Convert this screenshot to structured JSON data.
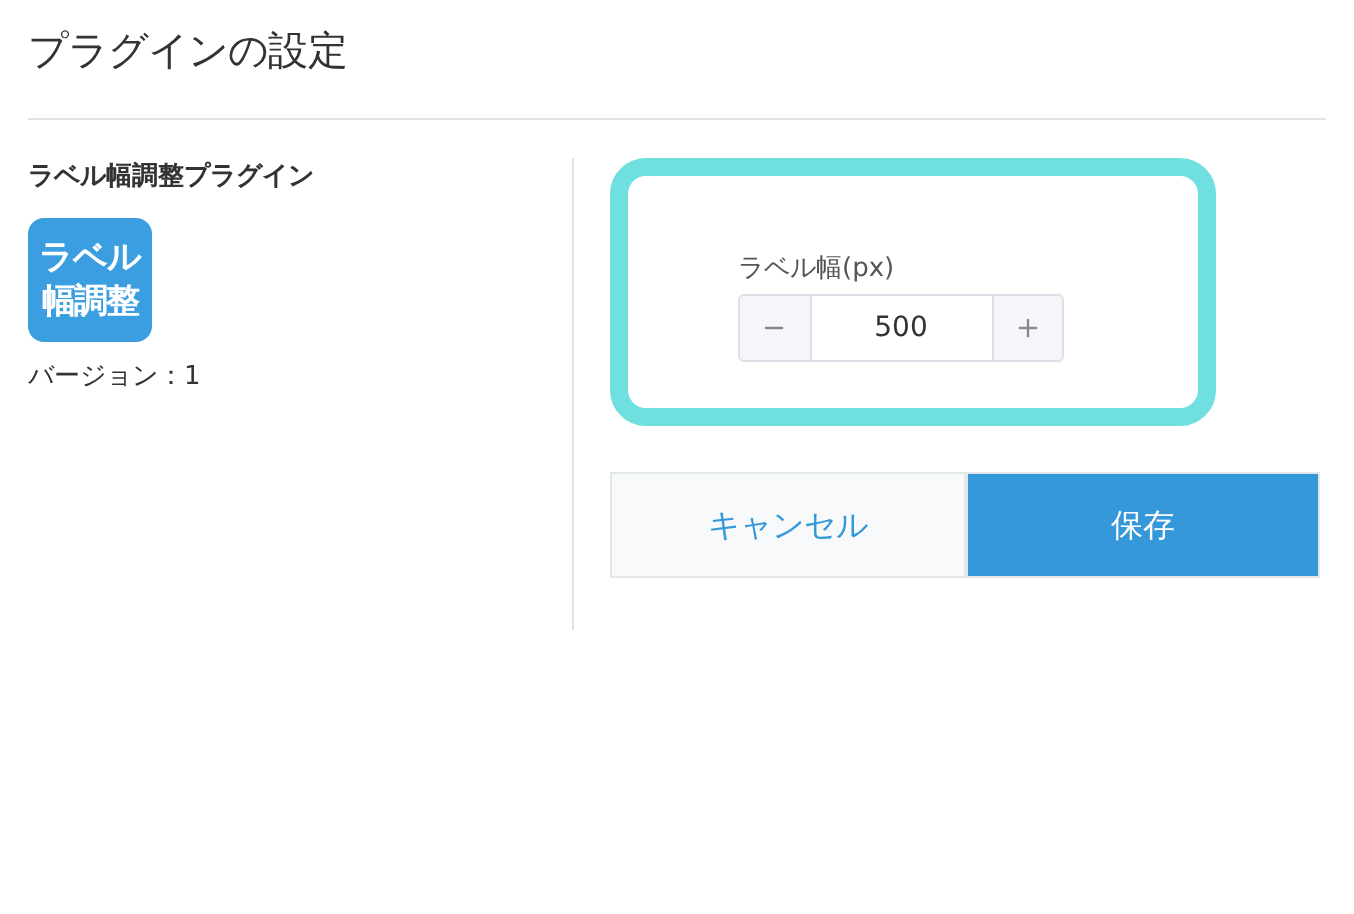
{
  "page_title": "プラグインの設定",
  "plugin": {
    "name": "ラベル幅調整プラグイン",
    "icon_lines": [
      "ラベル",
      "幅調整"
    ],
    "version": "バージョン：1"
  },
  "setting": {
    "label": "ラベル幅(px)",
    "value": "500"
  },
  "buttons": [
    {
      "label": "キャンセル",
      "kind": "cancel"
    },
    {
      "label": "保存",
      "kind": "save"
    }
  ]
}
